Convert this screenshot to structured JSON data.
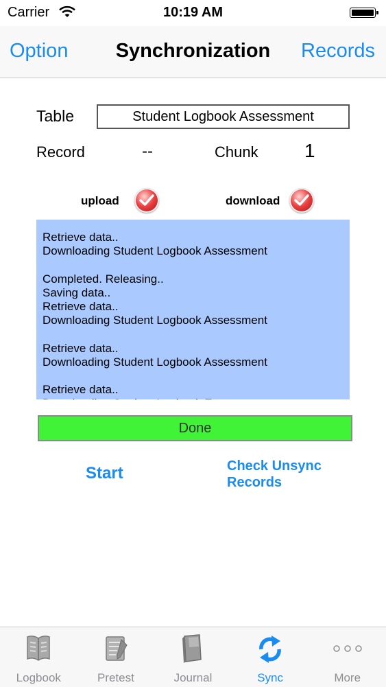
{
  "status_bar": {
    "carrier": "Carrier",
    "time": "10:19 AM"
  },
  "nav": {
    "left": "Option",
    "title": "Synchronization",
    "right": "Records"
  },
  "form": {
    "table_label": "Table",
    "table_value": "Student Logbook Assessment",
    "record_label": "Record",
    "record_value": "--",
    "chunk_label": "Chunk",
    "chunk_value": "1",
    "upload_label": "upload",
    "download_label": "download"
  },
  "log": {
    "lines": [
      "Retrieve data..",
      "Downloading Student Logbook Assessment",
      "",
      "Completed. Releasing..",
      "Saving data..",
      "Retrieve data..",
      "Downloading Student Logbook Assessment",
      "",
      "Retrieve data..",
      "Downloading Student Logbook Assessment",
      "",
      "Retrieve data..",
      "Downloading Student Logbook Entry"
    ]
  },
  "progress": {
    "label": "Done",
    "value": 1.0,
    "color": "#41f337"
  },
  "actions": {
    "start": "Start",
    "check_unsync_line1": "Check Unsync",
    "check_unsync_line2": "Records"
  },
  "colors": {
    "accent": "#1a8cf0",
    "log_bg": "#a9c9ff"
  },
  "tabs": [
    {
      "label": "Logbook",
      "icon": "book-icon",
      "active": false
    },
    {
      "label": "Pretest",
      "icon": "test-sheet-icon",
      "active": false
    },
    {
      "label": "Journal",
      "icon": "journal-icon",
      "active": false
    },
    {
      "label": "Sync",
      "icon": "sync-icon",
      "active": true
    },
    {
      "label": "More",
      "icon": "more-dots-icon",
      "active": false
    }
  ]
}
